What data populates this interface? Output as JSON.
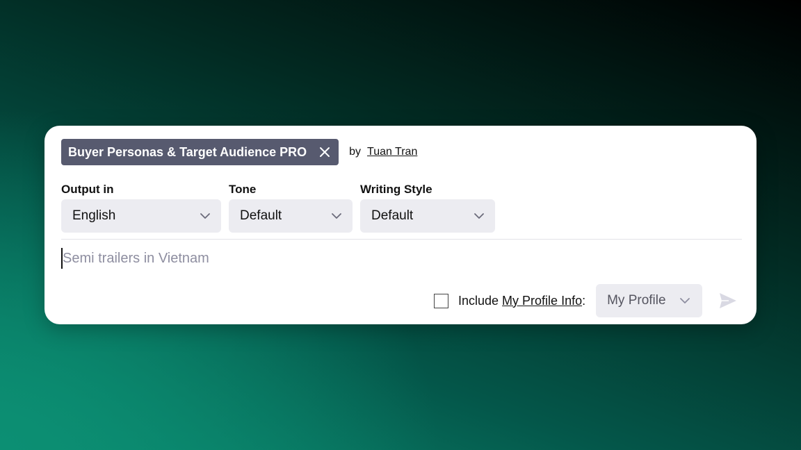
{
  "prompt_template": {
    "title": "Buyer Personas & Target Audience PRO",
    "by_label": "by",
    "author": "Tuan Tran"
  },
  "output": {
    "label": "Output in",
    "value": "English"
  },
  "tone": {
    "label": "Tone",
    "value": "Default"
  },
  "writing_style": {
    "label": "Writing Style",
    "value": "Default"
  },
  "prompt_input": {
    "value": "",
    "placeholder": "Semi trailers in Vietnam"
  },
  "profile": {
    "include_prefix": "Include ",
    "include_link": "My Profile Info",
    "include_suffix": ":",
    "checked": false,
    "selected": "My Profile"
  },
  "colors": {
    "chip_bg": "#575a6f",
    "select_bg": "#ececf1",
    "send_icon": "#d9d9e3"
  }
}
